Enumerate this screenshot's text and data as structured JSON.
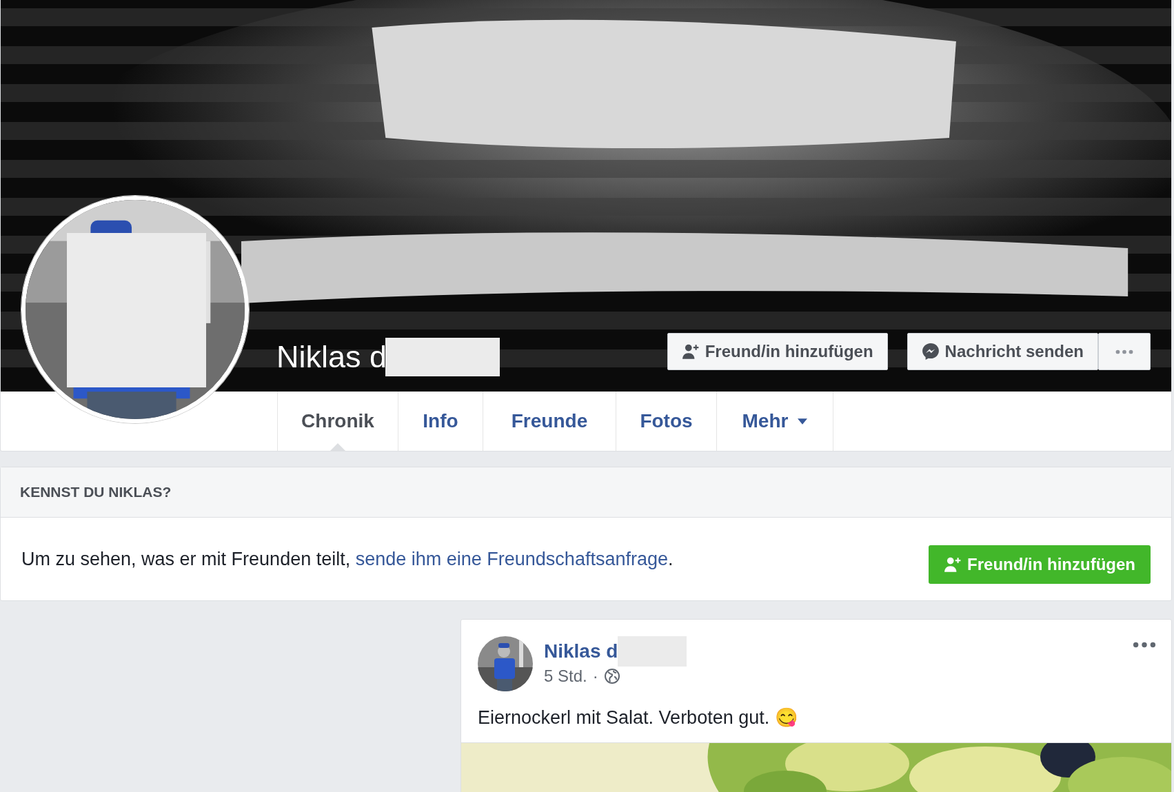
{
  "profile": {
    "name": "Niklas d",
    "redacted": true,
    "actions": [
      {
        "kind": "add-friend",
        "label": "Freund/in hinzufügen"
      },
      {
        "kind": "message",
        "label": "Nachricht senden"
      },
      {
        "kind": "more"
      }
    ]
  },
  "tabs": [
    {
      "label": "Chronik",
      "selected": true,
      "dropdown": false
    },
    {
      "label": "Info",
      "selected": false,
      "dropdown": false
    },
    {
      "label": "Freunde",
      "selected": false,
      "dropdown": false
    },
    {
      "label": "Fotos",
      "selected": false,
      "dropdown": false
    },
    {
      "label": "Mehr",
      "selected": false,
      "dropdown": true
    }
  ],
  "prompt": {
    "title": "KENNST DU NIKLAS?",
    "text": "Um zu sehen, was er mit Freunden teilt, ",
    "link": "sende ihm eine Freundschaftsanfrage",
    "after": ".",
    "button": "Freund/in hinzufügen"
  },
  "post": {
    "author": "Niklas d",
    "redacted": true,
    "time": "5 Std.",
    "separator": "·",
    "public": true,
    "text": "Eiernockerl mit Salat. Verboten gut. 😋"
  }
}
